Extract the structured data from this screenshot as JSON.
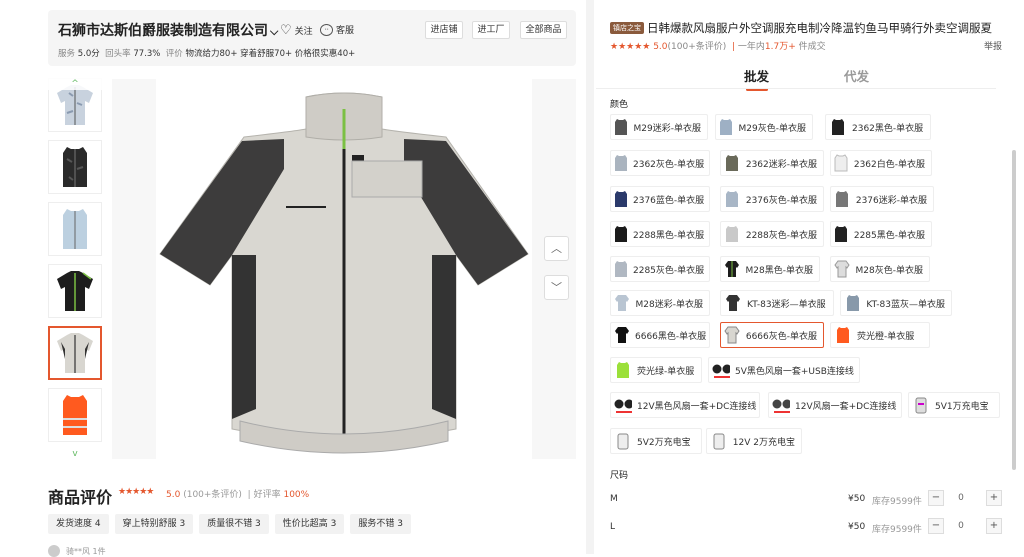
{
  "shop": {
    "name": "石狮市达斯伯爵服装制造有限公司",
    "follow": "关注",
    "service": "客服",
    "btn_enter": "进店铺",
    "btn_factory": "进工厂",
    "btn_all": "全部商品",
    "stat_service_label": "服务",
    "stat_service_value": "5.0分",
    "stat_repeat_label": "回头率",
    "stat_repeat_value": "77.3%",
    "stat_review_label": "评价",
    "stat_review_items": "物流给力80+   穿着舒服70+   价格很实惠40+"
  },
  "gallery": {
    "thumbs": [
      "camo-jacket",
      "black-camo-vest",
      "gray-vest",
      "black-jacket",
      "gray-jacket",
      "orange-vest"
    ],
    "selected_index": 4,
    "nav_up": "^",
    "nav_down": "v"
  },
  "reviews": {
    "title": "商品评价",
    "score": "5.0",
    "count": "(100+条评价)",
    "good_rate_label": "好评率",
    "good_rate": "100%",
    "tags": [
      "发货速度 4",
      "穿上特别舒服 3",
      "质量很不错 3",
      "性价比超高 3",
      "服务不错 3"
    ],
    "user_partial": "骑**风   1件"
  },
  "product": {
    "badge": "镇店之宝",
    "title": "日韩爆款风扇服户外空调服充电制冷降温钓鱼马甲骑行外卖空调服夏",
    "score": "5.0",
    "count": "(100+条评价)",
    "sales_prefix": "一年内",
    "sales_value": "1.7万+",
    "sales_suffix": "件成交",
    "report": "举报"
  },
  "tabs": {
    "wholesale": "批发",
    "dropship": "代发"
  },
  "color_label": "颜色",
  "colors": [
    "M29迷彩-单衣服",
    "M29灰色-单衣服",
    "2362黑色-单衣服",
    "2362灰色-单衣服",
    "2362迷彩-单衣服",
    "2362白色-单衣服",
    "2376蓝色-单衣服",
    "2376灰色-单衣服",
    "2376迷彩-单衣服",
    "2288黑色-单衣服",
    "2288灰色-单衣服",
    "2285黑色-单衣服",
    "2285灰色-单衣服",
    "M28黑色-单衣服",
    "M28灰色-单衣服",
    "M28迷彩-单衣服",
    "KT-83迷彩—单衣服",
    "KT-83蓝灰—单衣服",
    "6666黑色-单衣服",
    "6666灰色-单衣服",
    "荧光橙-单衣服",
    "荧光绿-单衣服",
    "5V黑色风扇一套+USB连接线",
    "12V黑色风扇一套+DC连接线",
    "12V风扇一套+DC连接线",
    "5V1万充电宝",
    "5V2万充电宝",
    "12V 2万充电宝"
  ],
  "selected_color": "6666灰色-单衣服",
  "size_label": "尺码",
  "sizes": [
    {
      "name": "M",
      "price": "¥50",
      "stock": "库存9599件",
      "qty": "0"
    },
    {
      "name": "L",
      "price": "¥50",
      "stock": "库存9599件",
      "qty": "0"
    }
  ],
  "colors_theme": {
    "accent": "#e4572e",
    "badge": "#8a5a3c",
    "sales": "#e4572e"
  }
}
